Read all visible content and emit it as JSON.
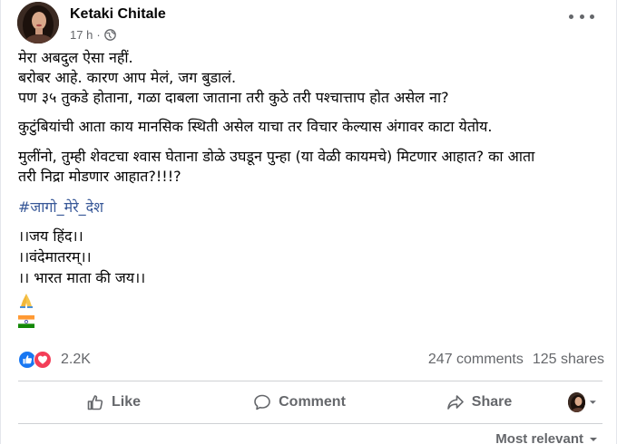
{
  "header": {
    "author": "Ketaki Chitale",
    "time": "17 h",
    "separator": "·",
    "audience_icon": "globe-icon",
    "more_icon": "more-options-icon"
  },
  "post": {
    "lines": [
      "मेरा अबदुल ऐसा नहीं.",
      "बरोबर आहे. कारण आप मेलं, जग बुडालं.",
      "पण ३५ तुकडे होताना, गळा दाबला जाताना तरी कुठे तरी पश्चात्ताप होत असेल ना?",
      "कुटुंबियांची आता काय मानसिक स्थिती असेल याचा तर विचार केल्यास अंगावर काटा येतोय.",
      "मुलींनो, तुम्ही शेवटचा श्वास घेताना डोळे उघडून पुन्हा (या वेळी कायमचे) मिटणार आहात? का आता\nतरी निद्रा मोडणार आहात?!!!?",
      "#जागो_मेरे_देश",
      "।।जय हिंद।।",
      "।।वंदेमातरम्।।",
      "।। भारत माता की जय।।"
    ],
    "emojis": [
      "folded-hands-emoji",
      "india-flag-emoji"
    ]
  },
  "reactions": {
    "icons": [
      "like-reaction-icon",
      "love-reaction-icon"
    ],
    "count": "2.2K",
    "comments": "247 comments",
    "shares": "125 shares"
  },
  "actions": {
    "like": "Like",
    "comment": "Comment",
    "share": "Share"
  },
  "sort": {
    "label": "Most relevant"
  },
  "colors": {
    "text": "#050505",
    "secondary": "#65676b",
    "link": "#385898",
    "like_blue": "#1877f2",
    "love_red": "#f33e58",
    "divider": "#ced0d4"
  }
}
